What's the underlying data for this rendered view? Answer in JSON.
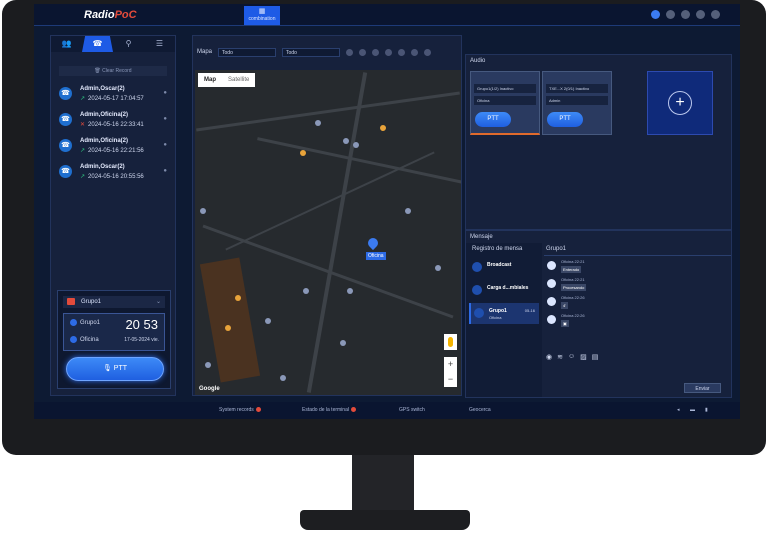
{
  "app": {
    "logo_main": "Radio",
    "logo_accent": "PoC",
    "top_tab": "combination"
  },
  "left": {
    "clear_record": "🗑 Clear Record",
    "records": [
      {
        "name": "Admin,Oscar(2)",
        "time": "2024-05-17 17:04:57",
        "dir": "in"
      },
      {
        "name": "Admin,Oficina(2)",
        "time": "2024-05-16 22:33:41",
        "dir": "missed"
      },
      {
        "name": "Admin,Oficina(2)",
        "time": "2024-05-16 22:21:56",
        "dir": "in"
      },
      {
        "name": "Admin,Oscar(2)",
        "time": "2024-05-16 20:55:56",
        "dir": "in"
      }
    ],
    "group_select": "Grupo1",
    "card_group": "Grupo1",
    "card_number": "20 53",
    "card_user": "Oficina",
    "card_date": "17-05-2024 vie.",
    "ptt": "PTT"
  },
  "map": {
    "label": "Mapa",
    "filter1": "Todo",
    "filter2": "Todo",
    "tab_map": "Map",
    "tab_satellite": "Satellite",
    "pin_label": "Oficina",
    "google": "Google"
  },
  "audio": {
    "title": "Audio",
    "card1_row1": "Grupo1(1/2)  Inactivo",
    "card1_row2": "Oficina",
    "card1_ptt": "PTT",
    "card2_row1": "TXE...X 2(0/1)  Inactivo",
    "card2_row2": "Admin",
    "card2_ptt": "PTT"
  },
  "mensaje": {
    "title": "Mensaje",
    "registro": "Registro de mensa",
    "items": [
      {
        "name": "Broadcast",
        "sub": "",
        "time": ""
      },
      {
        "name": "Carga d...mbiales",
        "sub": "",
        "time": ""
      },
      {
        "name": "Grupo1",
        "sub": "Oficina",
        "time": "05-16"
      }
    ],
    "chat_title": "Grupo1",
    "bubbles": [
      {
        "who": "Oficina 22:21",
        "text": "Enterado"
      },
      {
        "who": "Oficina 22:21",
        "text": "Procesando"
      },
      {
        "who": "Oficina 22:26",
        "text": "4'"
      },
      {
        "who": "Oficina 22:26",
        "text": ""
      }
    ],
    "enviar": "Enviar"
  },
  "status": {
    "system_records": "System records",
    "estado": "Estado de la terminal",
    "gps": "GPS switch",
    "geocerca": "Geocerca"
  }
}
